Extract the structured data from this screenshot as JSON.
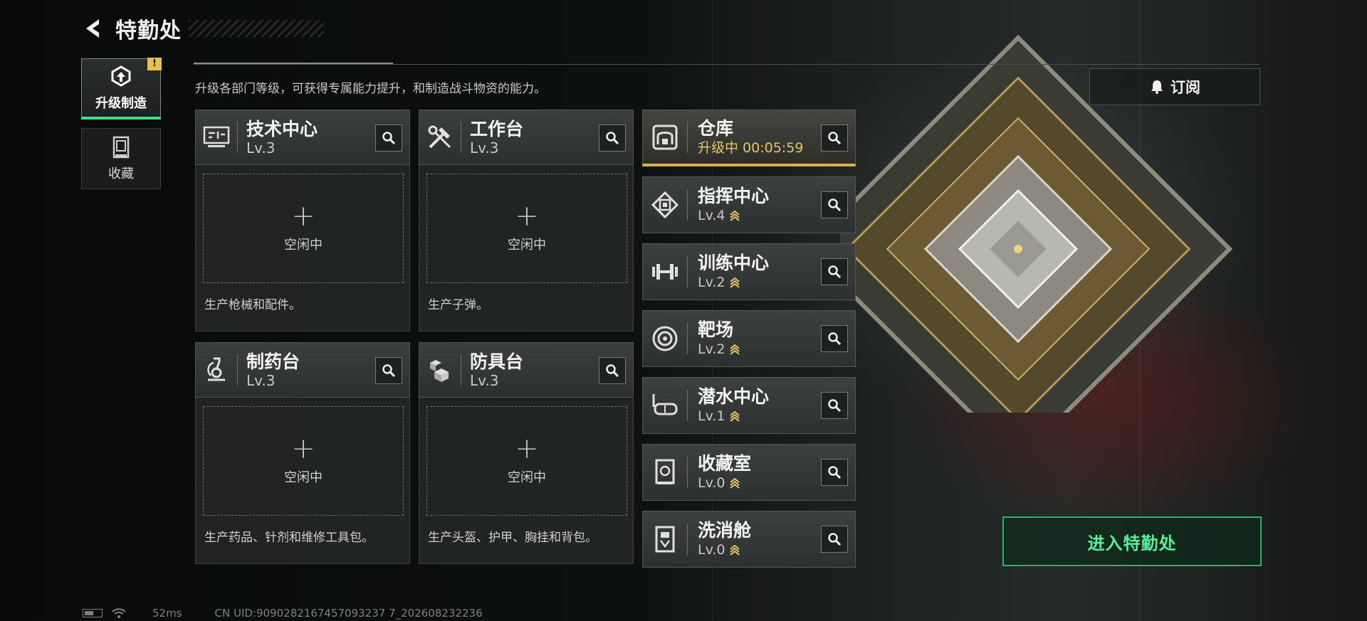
{
  "header": {
    "title": "特勤处"
  },
  "sidenav": {
    "items": [
      {
        "label": "升级制造",
        "active": true,
        "badge": "!"
      },
      {
        "label": "收藏",
        "active": false
      }
    ]
  },
  "description": "升级各部门等级，可获得专属能力提升，和制造战斗物资的能力。",
  "subscribe_label": "订阅",
  "workshops": [
    {
      "name": "技术中心",
      "level": "Lv.3",
      "slot_state": "空闲中",
      "desc": "生产枪械和配件。",
      "icon": "circuit-board-icon"
    },
    {
      "name": "工作台",
      "level": "Lv.3",
      "slot_state": "空闲中",
      "desc": "生产子弹。",
      "icon": "tools-icon"
    },
    {
      "name": "制药台",
      "level": "Lv.3",
      "slot_state": "空闲中",
      "desc": "生产药品、针剂和维修工具包。",
      "icon": "microscope-icon"
    },
    {
      "name": "防具台",
      "level": "Lv.3",
      "slot_state": "空闲中",
      "desc": "生产头盔、护甲、胸挂和背包。",
      "icon": "armor-boxes-icon"
    }
  ],
  "departments": [
    {
      "name": "仓库",
      "status": "升级中 00:05:59",
      "icon": "warehouse-icon",
      "upgrading": true
    },
    {
      "name": "指挥中心",
      "level": "Lv.4",
      "icon": "chip-icon",
      "upgradable": true
    },
    {
      "name": "训练中心",
      "level": "Lv.2",
      "icon": "dumbbell-icon",
      "upgradable": true
    },
    {
      "name": "靶场",
      "level": "Lv.2",
      "icon": "target-icon",
      "upgradable": true
    },
    {
      "name": "潜水中心",
      "level": "Lv.1",
      "icon": "diving-mask-icon",
      "upgradable": true
    },
    {
      "name": "收藏室",
      "level": "Lv.0",
      "icon": "collection-room-icon",
      "upgradable": true
    },
    {
      "name": "洗消舱",
      "level": "Lv.0",
      "icon": "decontamination-icon",
      "upgradable": true
    }
  ],
  "enter_label": "进入特勤处",
  "statusbar": {
    "ping": "52ms",
    "uid": "CN UID:9090282167457093237 7_202608232236"
  },
  "colors": {
    "accent_green": "#59ef9a",
    "upgrade_gold": "#e9c766",
    "badge_yellow": "#e7c04a"
  }
}
